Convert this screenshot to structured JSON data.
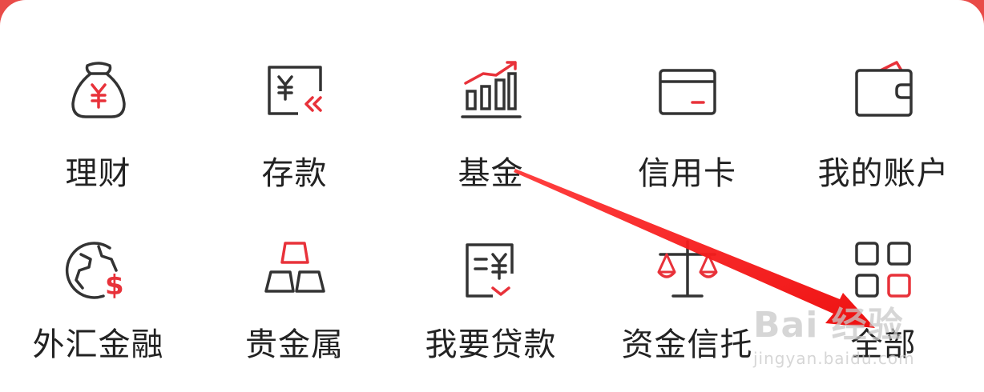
{
  "colors": {
    "accent": "#e8323a",
    "stroke": "#333333",
    "background": "#e94b48"
  },
  "menu": {
    "row1": [
      {
        "label": "理财",
        "icon": "money-bag-icon"
      },
      {
        "label": "存款",
        "icon": "deposit-icon"
      },
      {
        "label": "基金",
        "icon": "fund-chart-icon"
      },
      {
        "label": "信用卡",
        "icon": "credit-card-icon"
      },
      {
        "label": "我的账户",
        "icon": "wallet-icon"
      }
    ],
    "row2": [
      {
        "label": "外汇金融",
        "icon": "globe-dollar-icon"
      },
      {
        "label": "贵金属",
        "icon": "gold-bars-icon"
      },
      {
        "label": "我要贷款",
        "icon": "loan-document-icon"
      },
      {
        "label": "资金信托",
        "icon": "scales-icon"
      },
      {
        "label": "全部",
        "icon": "grid-all-icon"
      }
    ]
  },
  "watermark": {
    "brand": "Bai 经验",
    "sub": "jingyan.baidu.com"
  }
}
